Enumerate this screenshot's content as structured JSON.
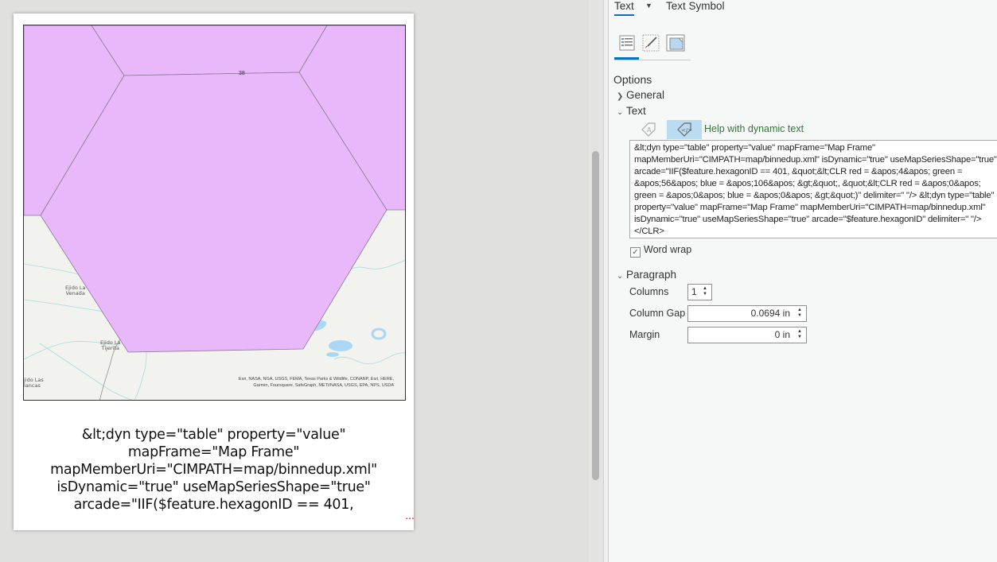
{
  "layout_page": {
    "map": {
      "hexagon_label": "38",
      "hexagon_fill": "#e9b8fb",
      "basemap_bg": "#f2f2ee",
      "water_color": "#a8d8f5",
      "places": [
        {
          "name": "Ejido La Venada"
        },
        {
          "name": "Ejido La Tijerita"
        },
        {
          "name": "Ejido Las Blancas"
        }
      ],
      "place_lines": {
        "venada": [
          "Ejido La",
          "Venada"
        ],
        "tijerita": [
          "Ejido La",
          "Tijerita"
        ],
        "blancas": [
          "jido Las",
          "lancas"
        ]
      },
      "attribution_line1": "Esri, NASA, NGA, USGS, FEMA, Texas Parks & Wildlife, CONANP, Esri, HERE,",
      "attribution_line2": "Garmin, Foursquare, SafeGraph, METI/NASA, USGS, EPA, NPS, USDA"
    },
    "text_element": "&lt;dyn type=\"table\" property=\"value\" mapFrame=\"Map Frame\" mapMemberUri=\"CIMPATH=map/binnedup.xml\" isDynamic=\"true\" useMapSeriesShape=\"true\" arcade=\"IIF($feature.hexagonID == 401, &quot;&lt;CLR red = &apos;4&apos; green = &apos;56&apos; blue = &apos;106&apos; &gt;&quot;, &quot;&lt;CLR red = &apos;0&apos; green = &apos;0&apos; blue = &apos;0&apos; &gt;&quot;)\" delimiter=\" \"/>",
    "overflow_indicator": "..."
  },
  "format_pane": {
    "tabs": [
      {
        "label": "Text",
        "active": true
      },
      {
        "label": "Text Symbol",
        "active": false
      }
    ],
    "icon_tabs": [
      {
        "name": "general-properties",
        "active": true
      },
      {
        "name": "display",
        "active": false
      },
      {
        "name": "placement",
        "active": false
      }
    ],
    "options_label": "Options",
    "sections": {
      "general": {
        "label": "General",
        "expanded": false
      },
      "text": {
        "label": "Text",
        "expanded": true
      },
      "paragraph": {
        "label": "Paragraph",
        "expanded": true
      }
    },
    "text_section": {
      "help_dynamic_text": "Help with dynamic text",
      "editor_value": "&lt;dyn type=\"table\" property=\"value\" mapFrame=\"Map Frame\" mapMemberUri=\"CIMPATH=map/binnedup.xml\" isDynamic=\"true\" useMapSeriesShape=\"true\" arcade=\"IIF($feature.hexagonID == 401, &quot;&lt;CLR red = &apos;4&apos; green = &apos;56&apos; blue = &apos;106&apos; &gt;&quot;, &quot;&lt;CLR red = &apos;0&apos; green = &apos;0&apos; blue = &apos;0&apos; &gt;&quot;)\" delimiter=\" \"/> &lt;dyn type=\"table\" property=\"value\" mapFrame=\"Map Frame\" mapMemberUri=\"CIMPATH=map/binnedup.xml\" isDynamic=\"true\" useMapSeriesShape=\"true\" arcade=\"$feature.hexagonID\" delimiter=\" \"/></CLR>",
      "word_wrap_label": "Word wrap",
      "word_wrap_checked": true
    },
    "paragraph_section": {
      "columns_label": "Columns",
      "columns_value": "1",
      "column_gap_label": "Column Gap",
      "column_gap_value": "0.0694 in",
      "margin_label": "Margin",
      "margin_value": "0 in"
    },
    "accent_color": "#0a70b8"
  }
}
